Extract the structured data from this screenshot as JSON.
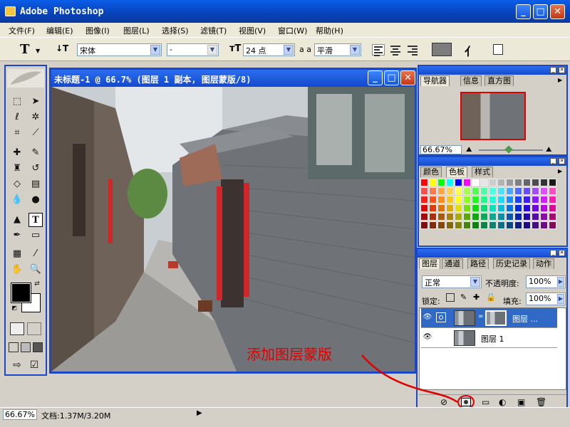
{
  "app": {
    "title": "Adobe Photoshop"
  },
  "menu": [
    "文件(F)",
    "编辑(E)",
    "图像(I)",
    "图层(L)",
    "选择(S)",
    "滤镜(T)",
    "视图(V)",
    "窗口(W)",
    "帮助(H)"
  ],
  "options": {
    "font_family": "宋体",
    "font_style": "-",
    "font_size": "24 点",
    "antialias_label": "a a",
    "antialias": "平滑"
  },
  "document": {
    "title": "未标题-1 @ 66.7% (图层 1 副本, 图层蒙版/8)"
  },
  "navigator": {
    "tabs": [
      "导航器",
      "信息",
      "直方图"
    ],
    "zoom": "66.67%"
  },
  "color_panel": {
    "tabs": [
      "颜色",
      "色板",
      "样式"
    ]
  },
  "layers_panel": {
    "tabs": [
      "图层",
      "通道",
      "路径",
      "历史记录",
      "动作"
    ],
    "blend_mode": "正常",
    "opacity_label": "不透明度:",
    "opacity": "100%",
    "lock_label": "锁定:",
    "fill_label": "填充:",
    "fill": "100%",
    "layers": [
      {
        "name": "图层 ..."
      },
      {
        "name": "图层 1"
      }
    ]
  },
  "status": {
    "zoom": "66.67%",
    "doc_info": "文档:1.37M/3.20M"
  },
  "annotation": "添加图层蒙版",
  "colors": {
    "title_blue": "#1b48c9",
    "annotation_red": "#e00000",
    "selection": "#3169c6"
  }
}
